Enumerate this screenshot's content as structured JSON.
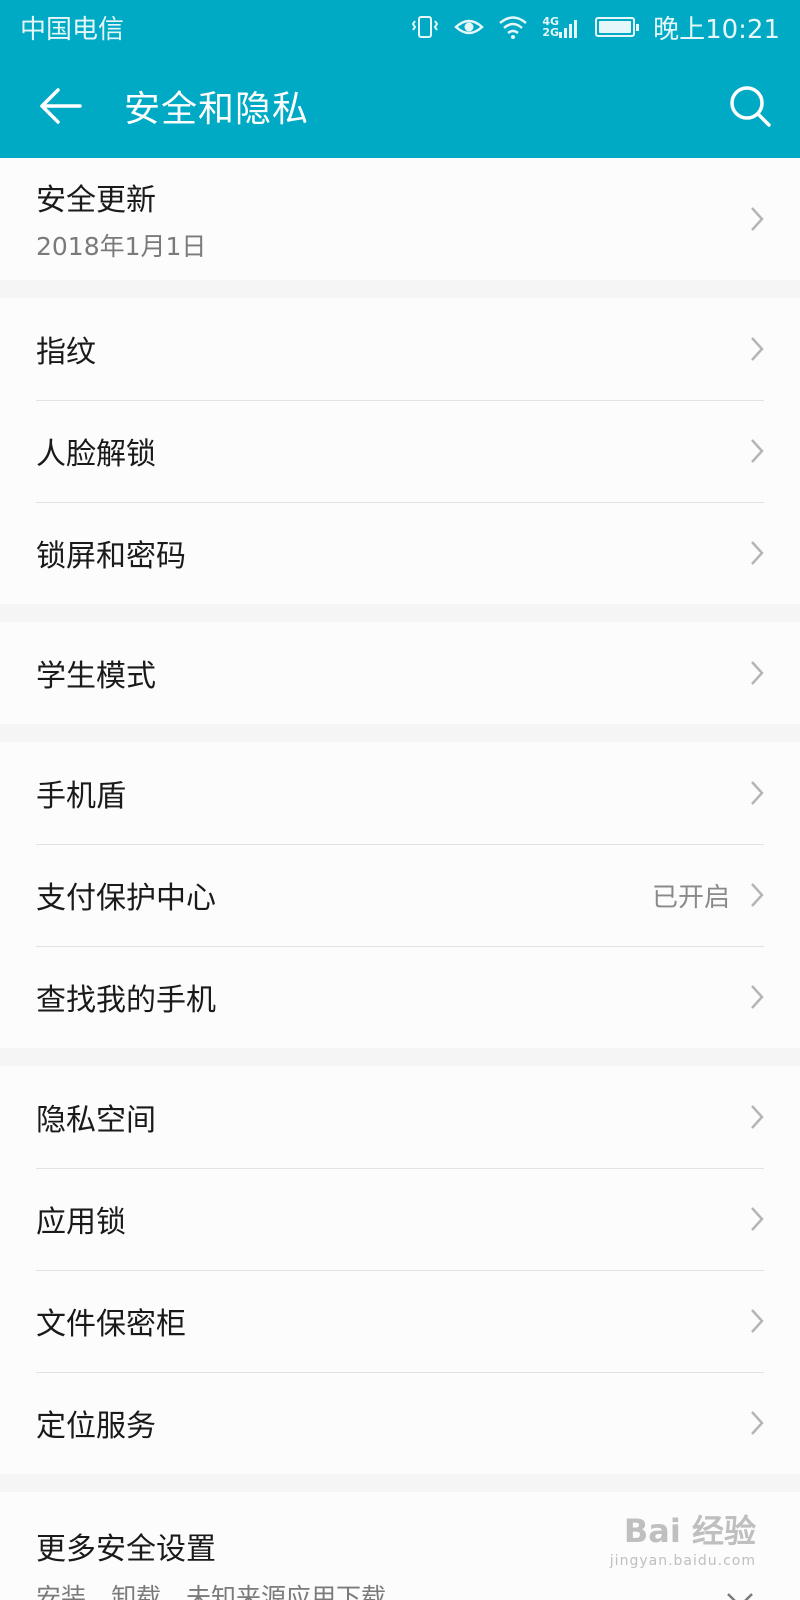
{
  "status_bar": {
    "carrier": "中国电信",
    "network_top": "4G",
    "network_bottom": "2G",
    "time": "晚上10:21",
    "battery_level": 1.0
  },
  "app_bar": {
    "title": "安全和隐私",
    "back_icon": "arrow-left-icon",
    "search_icon": "search-icon"
  },
  "groups": [
    {
      "items": [
        {
          "label": "安全更新",
          "subtitle": "2018年1月1日"
        }
      ]
    },
    {
      "items": [
        {
          "label": "指纹"
        },
        {
          "label": "人脸解锁"
        },
        {
          "label": "锁屏和密码"
        }
      ]
    },
    {
      "items": [
        {
          "label": "学生模式"
        }
      ]
    },
    {
      "items": [
        {
          "label": "手机盾"
        },
        {
          "label": "支付保护中心",
          "value": "已开启"
        },
        {
          "label": "查找我的手机"
        }
      ]
    },
    {
      "items": [
        {
          "label": "隐私空间"
        },
        {
          "label": "应用锁"
        },
        {
          "label": "文件保密柜"
        },
        {
          "label": "定位服务"
        }
      ]
    }
  ],
  "more": {
    "label": "更多安全设置",
    "subtitle": "安装、卸载、未知来源应用下载"
  },
  "watermark": {
    "text": "Bai 经验",
    "url": "jingyan.baidu.com"
  },
  "colors": {
    "accent": "#00a9c4",
    "background": "#f5f5f5",
    "card": "#fdfcfd"
  }
}
